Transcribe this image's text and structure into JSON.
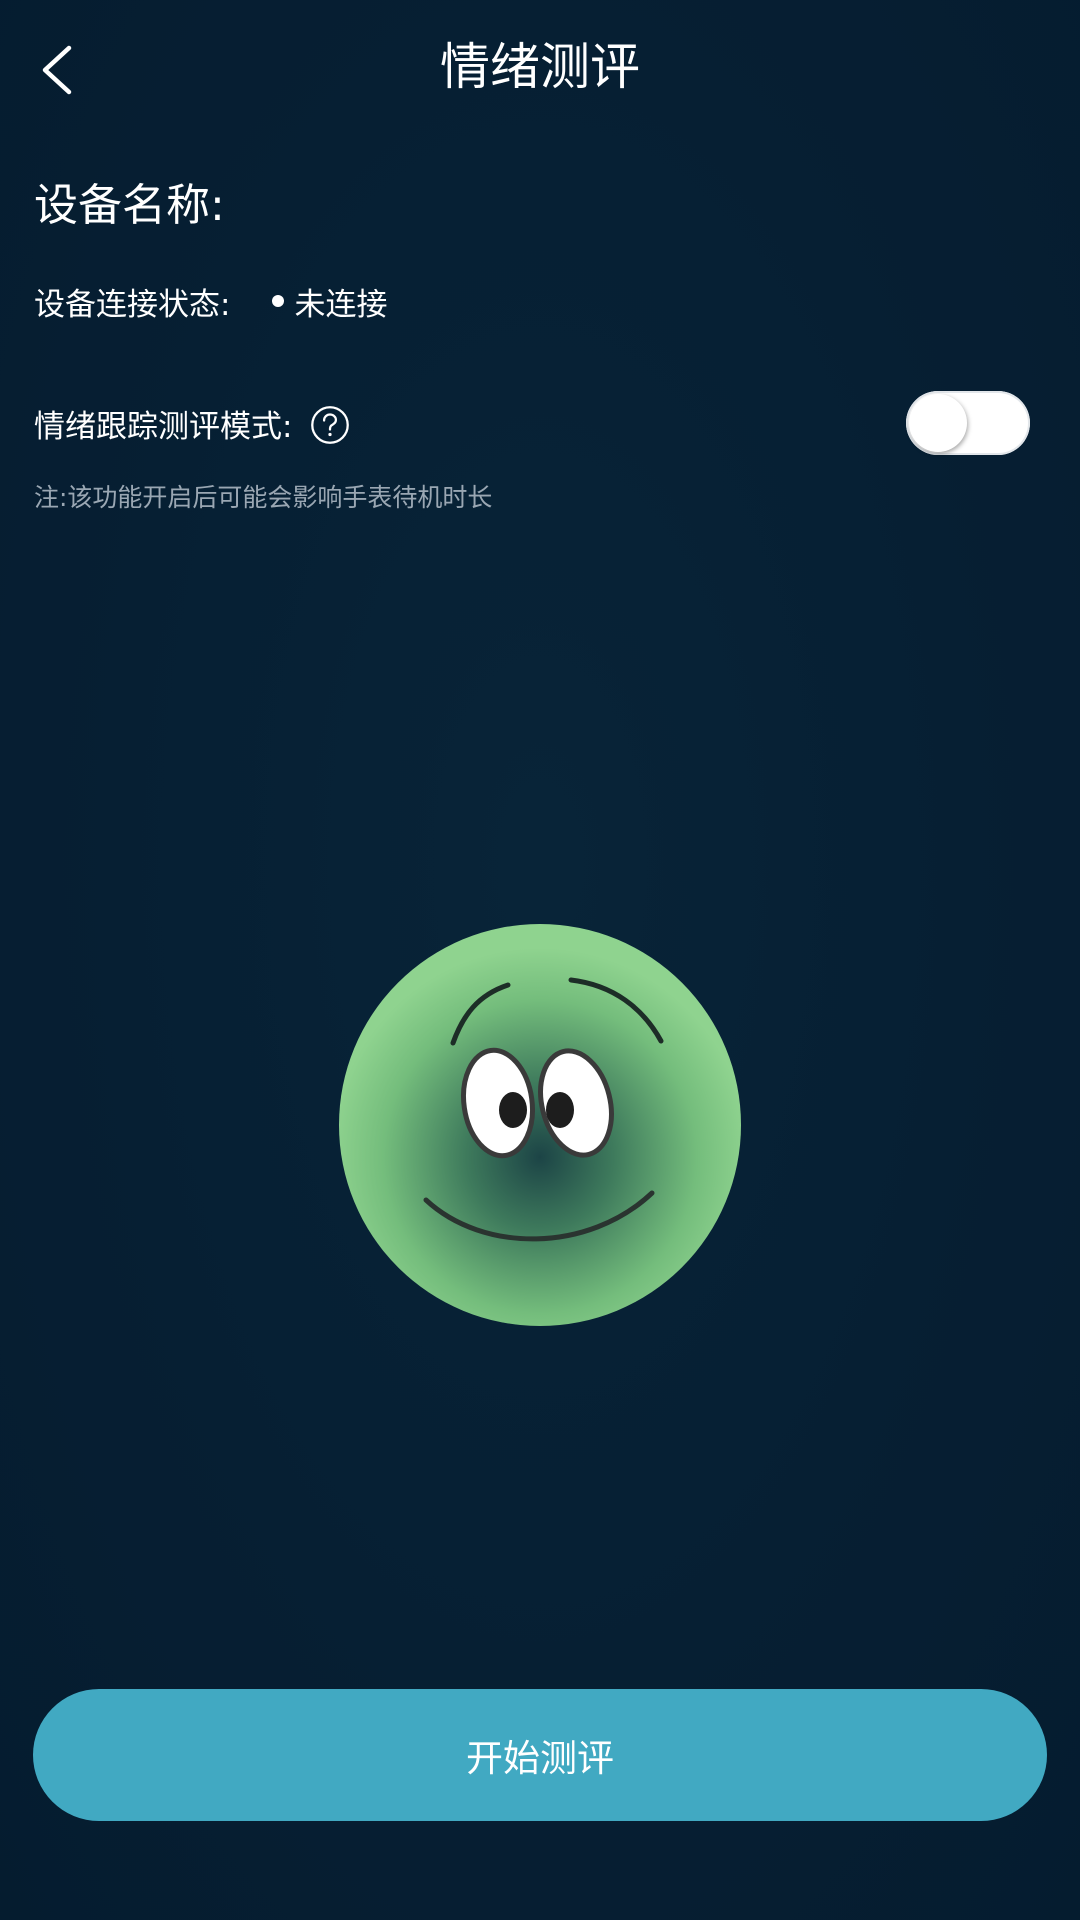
{
  "header": {
    "title": "情绪测评",
    "back_icon": "chevron-left-icon"
  },
  "device": {
    "name_label": "设备名称:",
    "status_label": "设备连接状态:",
    "status_value": "未连接"
  },
  "tracking_mode": {
    "label": "情绪跟踪测评模式:",
    "help_icon": "question-circle-icon",
    "enabled": false,
    "note": "注:该功能开启后可能会影响手表待机时长"
  },
  "mascot": {
    "icon": "smiley-face-icon",
    "color_light": "#8ed08e",
    "color_dark": "#1e4a48"
  },
  "actions": {
    "start_label": "开始测评",
    "start_color": "#41a9c2"
  }
}
